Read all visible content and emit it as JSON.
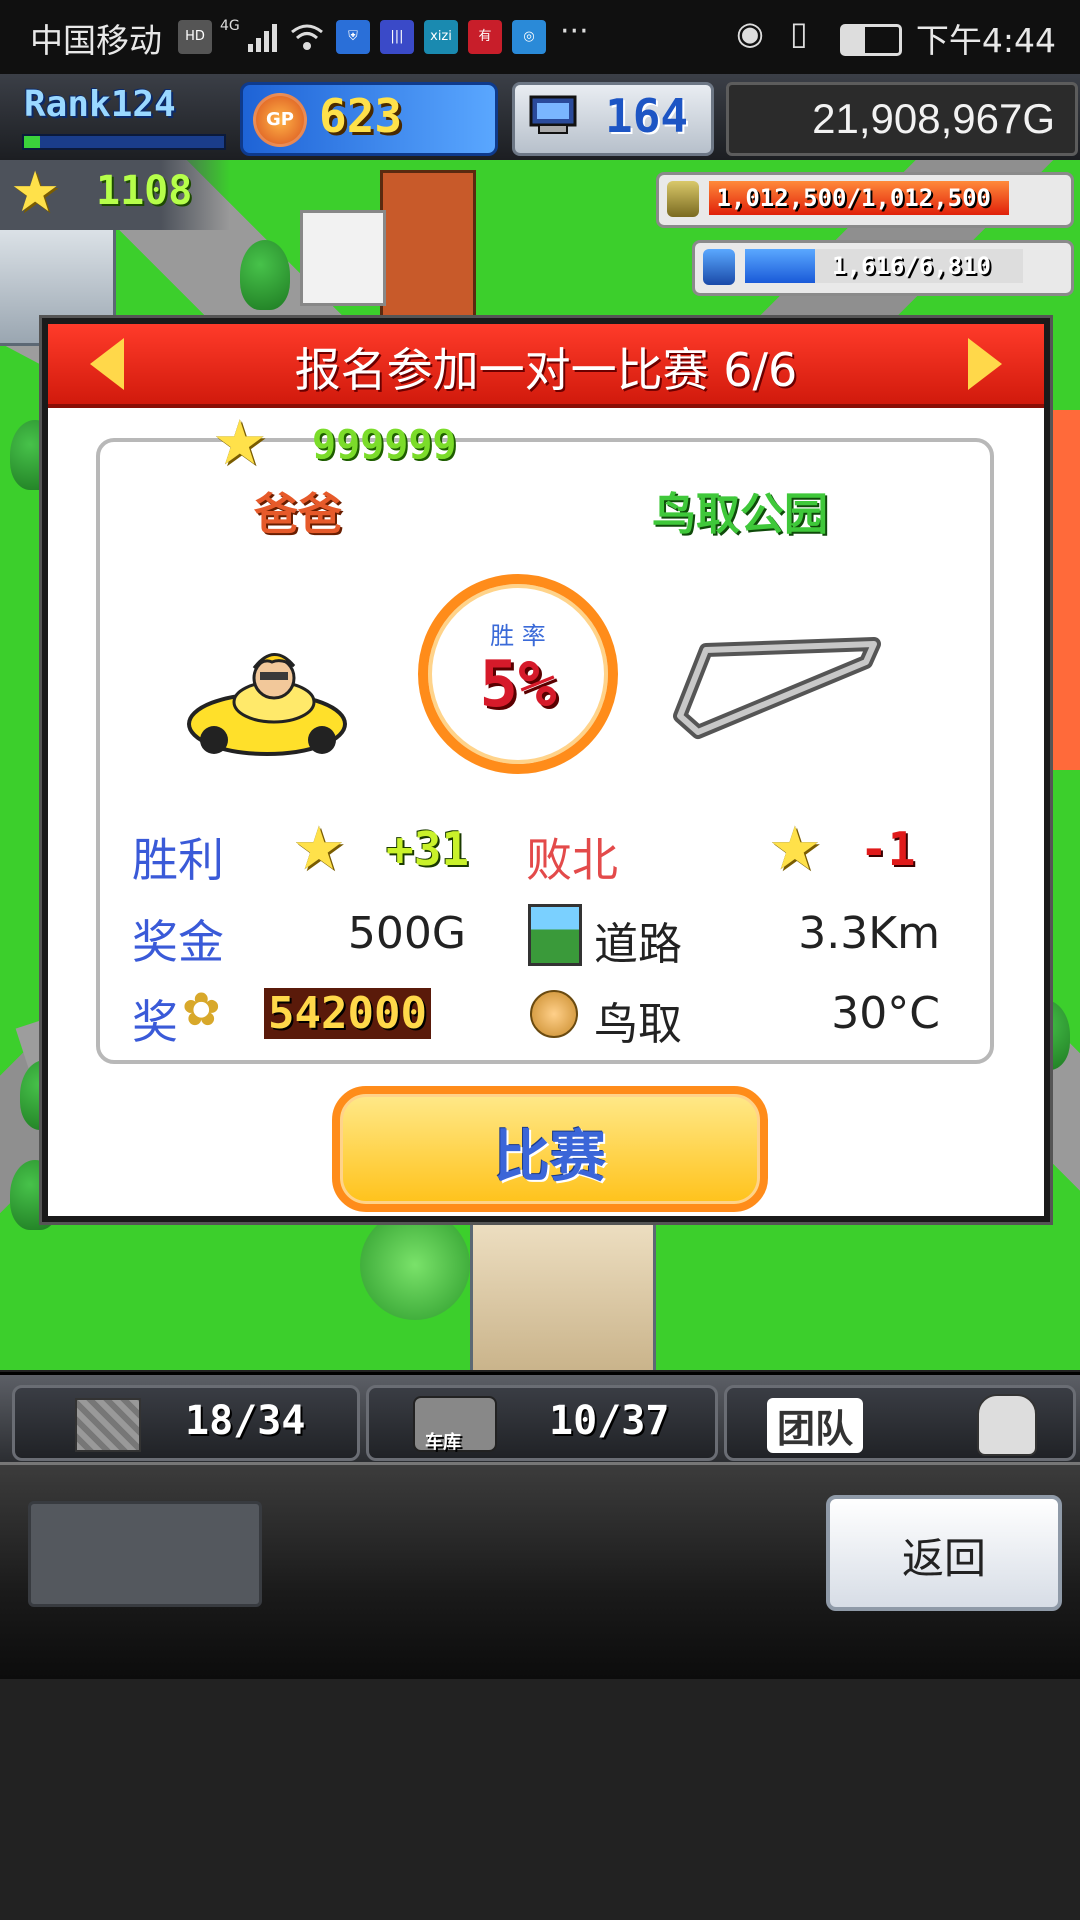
{
  "status_bar": {
    "carrier": "中国移动",
    "network": "4G",
    "time": "下午4:44"
  },
  "top_bar": {
    "rank_label": "Rank124",
    "gp_icon": "GP",
    "gp_value": "623",
    "pc_value": "164",
    "money": "21,908,967G"
  },
  "hud": {
    "star_count": "1108",
    "resource1": "1,012,500/1,012,500",
    "resource2": "1,616/6,810"
  },
  "dialog": {
    "title": "报名参加一对一比赛 6/6",
    "stars_required": "999999",
    "opponent": "爸爸",
    "course": "鸟取公园",
    "win_rate_label": "胜 率",
    "win_rate": "5%",
    "win_label": "胜利",
    "win_points": "+31",
    "lose_label": "败北",
    "lose_points": "-1",
    "prize_label": "奖金",
    "prize_value": "500G",
    "road_label": "道路",
    "road_value": "3.3Km",
    "bonus_label": "奖",
    "bonus_value": "542000",
    "location_label": "鸟取",
    "temperature": "30°C",
    "race_button": "比赛"
  },
  "bottom_bar": {
    "slot1_value": "18/34",
    "garage_label": "车库",
    "slot2_value": "10/37",
    "team_label": "团队"
  },
  "panel": {
    "back_button": "返回"
  }
}
